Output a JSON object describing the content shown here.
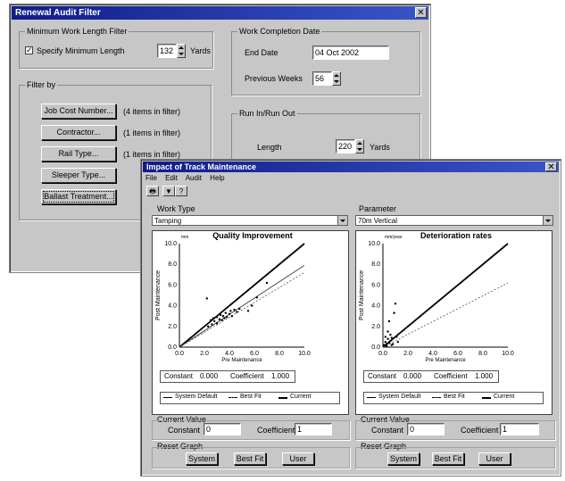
{
  "back_window": {
    "title": "Renewal Audit Filter",
    "close": "✕",
    "min_length": {
      "group_label": "Minimum Work Length Filter",
      "checkbox_label": "Specify Minimum Length",
      "checked": true,
      "value": "132",
      "unit": "Yards"
    },
    "filter_by": {
      "group_label": "Filter by",
      "rows": [
        {
          "button": "Job Cost Number...",
          "status": "(4 items in filter)"
        },
        {
          "button": "Contractor...",
          "status": "(1 items in filter)"
        },
        {
          "button": "Rail Type...",
          "status": "(1 items in filter)"
        },
        {
          "button": "Sleeper Type...",
          "status": ""
        },
        {
          "button": "Ballast Treatment...",
          "status": ""
        }
      ]
    },
    "completion": {
      "group_label": "Work Completion Date",
      "end_date_label": "End Date",
      "end_date_value": "04 Oct 2002",
      "prev_weeks_label": "Previous Weeks",
      "prev_weeks_value": "56"
    },
    "runinout": {
      "group_label": "Run In/Run Out",
      "length_label": "Length",
      "length_value": "220",
      "unit": "Yards"
    }
  },
  "front_window": {
    "title": "Impact of Track Maintenance",
    "close": "✕",
    "menu": [
      "File",
      "Edit",
      "Audit",
      "Help"
    ],
    "toolbar_icons": [
      "printer-icon",
      "filter-icon",
      "help-pointer-icon"
    ],
    "left_panel": {
      "combo_label": "Work Type",
      "combo_value": "Tamping",
      "constant_label": "Constant",
      "constant_readout": "0.000",
      "coefficient_label": "Coefficient",
      "coefficient_readout": "1.000",
      "legend": [
        "System Default",
        "Best Fit",
        "Current"
      ],
      "current_value_label": "Current Value",
      "cv_constant_label": "Constant",
      "cv_constant_value": "0",
      "cv_coefficient_label": "Coefficient",
      "cv_coefficient_value": "1",
      "reset_label": "Reset Graph",
      "buttons": [
        "System",
        "Best Fit",
        "User"
      ]
    },
    "right_panel": {
      "combo_label": "Parameter",
      "combo_value": "70m Vertical",
      "constant_label": "Constant",
      "constant_readout": "0.000",
      "coefficient_label": "Coefficient",
      "coefficient_readout": "1.000",
      "legend": [
        "System Default",
        "Best Fit",
        "Current"
      ],
      "current_value_label": "Current Value",
      "cv_constant_label": "Constant",
      "cv_constant_value": "0",
      "cv_coefficient_label": "Coefficient",
      "cv_coefficient_value": "1",
      "reset_label": "Reset Graph",
      "buttons": [
        "System",
        "Best Fit",
        "User"
      ]
    }
  },
  "chart_data": [
    {
      "type": "scatter",
      "title": "Quality Improvement",
      "unit_label": "mm",
      "xlabel": "Pre Maintenance",
      "ylabel": "Post Maintenance",
      "xlim": [
        0,
        10
      ],
      "ylim": [
        0,
        10
      ],
      "ticks": [
        "0.0",
        "2.0",
        "4.0",
        "6.0",
        "8.0",
        "10.0"
      ],
      "series": [
        {
          "name": "System Default",
          "style": "solid-thick",
          "x": [
            0,
            10
          ],
          "y": [
            0,
            10
          ]
        },
        {
          "name": "Best Fit",
          "style": "dashed",
          "x": [
            0,
            10
          ],
          "y": [
            0,
            7.2
          ]
        },
        {
          "name": "Current",
          "style": "solid",
          "x": [
            0,
            10
          ],
          "y": [
            0,
            7.9
          ]
        }
      ],
      "points": [
        [
          2.2,
          4.7
        ],
        [
          2.3,
          2.0
        ],
        [
          2.5,
          2.6
        ],
        [
          2.6,
          2.2
        ],
        [
          2.7,
          2.8
        ],
        [
          2.8,
          2.5
        ],
        [
          3.0,
          2.3
        ],
        [
          3.0,
          2.9
        ],
        [
          3.2,
          2.7
        ],
        [
          3.3,
          3.1
        ],
        [
          3.4,
          2.6
        ],
        [
          3.5,
          3.0
        ],
        [
          3.6,
          2.8
        ],
        [
          3.7,
          3.3
        ],
        [
          3.8,
          2.9
        ],
        [
          4.0,
          3.2
        ],
        [
          4.1,
          3.5
        ],
        [
          4.2,
          3.0
        ],
        [
          4.4,
          3.6
        ],
        [
          4.6,
          3.4
        ],
        [
          4.8,
          3.7
        ],
        [
          5.5,
          3.5
        ],
        [
          5.8,
          4.0
        ],
        [
          6.2,
          4.8
        ],
        [
          7.0,
          6.2
        ]
      ]
    },
    {
      "type": "scatter",
      "title": "Deterioration rates",
      "unit_label": "mm/year",
      "xlabel": "Pre Maintenance",
      "ylabel": "Post Maintenance",
      "xlim": [
        0,
        10
      ],
      "ylim": [
        0,
        10
      ],
      "ticks": [
        "0.0",
        "2.0",
        "4.0",
        "6.0",
        "8.0",
        "10.0"
      ],
      "series": [
        {
          "name": "System Default",
          "style": "solid-thick",
          "x": [
            0,
            10
          ],
          "y": [
            0,
            10
          ]
        },
        {
          "name": "Best Fit",
          "style": "dashed",
          "x": [
            0,
            10
          ],
          "y": [
            0,
            6.2
          ]
        }
      ],
      "points": [
        [
          0.1,
          0.2
        ],
        [
          0.2,
          0.5
        ],
        [
          0.2,
          1.0
        ],
        [
          0.3,
          0.3
        ],
        [
          0.4,
          0.8
        ],
        [
          0.4,
          1.5
        ],
        [
          0.5,
          0.4
        ],
        [
          0.5,
          2.5
        ],
        [
          0.6,
          1.2
        ],
        [
          0.6,
          0.6
        ],
        [
          0.7,
          0.9
        ],
        [
          0.8,
          0.3
        ],
        [
          0.9,
          3.3
        ],
        [
          1.0,
          4.2
        ],
        [
          1.1,
          1.0
        ],
        [
          0.3,
          0.1
        ],
        [
          0.7,
          0.2
        ],
        [
          1.2,
          0.5
        ]
      ]
    }
  ]
}
